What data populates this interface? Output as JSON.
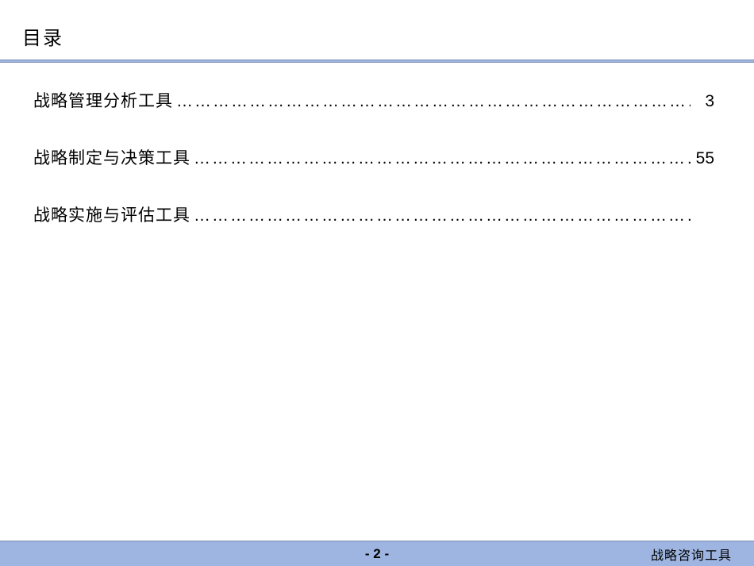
{
  "header": {
    "title": "目录"
  },
  "toc": {
    "entries": [
      {
        "label": "战略管理分析工具",
        "page": "3"
      },
      {
        "label": "战略制定与决策工具",
        "page": "55"
      },
      {
        "label": "战略实施与评估工具",
        "page": ""
      }
    ],
    "dots": "……………………………………………………………………………………"
  },
  "footer": {
    "page_number": "- 2 -",
    "text": "战略咨询工具"
  }
}
